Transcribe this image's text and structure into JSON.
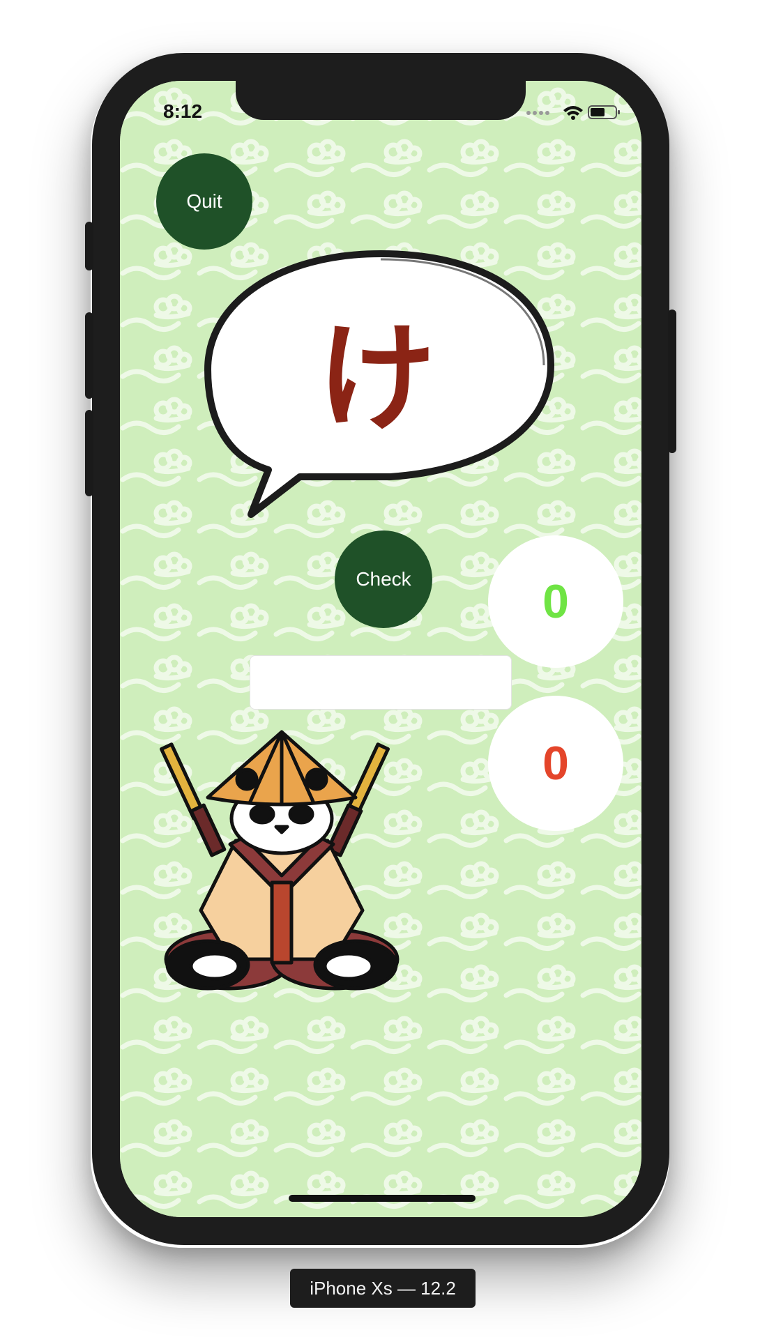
{
  "status_bar": {
    "time": "8:12"
  },
  "quit_button": {
    "label": "Quit"
  },
  "prompt": {
    "kana": "け"
  },
  "check_button": {
    "label": "Check"
  },
  "scores": {
    "correct": "0",
    "wrong": "0"
  },
  "answer_input": {
    "value": "",
    "placeholder": ""
  },
  "device_label": "iPhone Xs — 12.2",
  "colors": {
    "background": "#cfeebc",
    "button": "#1f5128",
    "kana": "#8b2415",
    "correct": "#6fe444",
    "wrong": "#e4452a"
  },
  "icons": [
    "signal-icon",
    "wifi-icon",
    "battery-icon",
    "panda-samurai-mascot"
  ]
}
